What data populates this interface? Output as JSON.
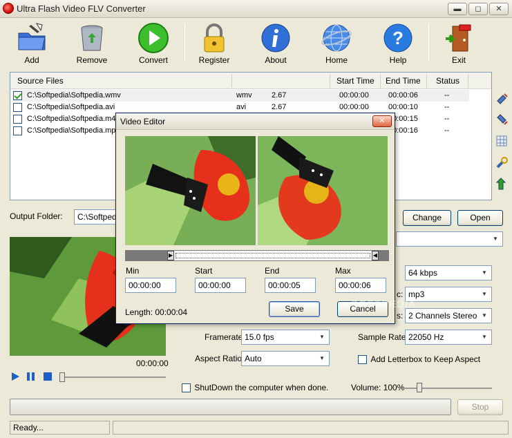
{
  "window": {
    "title": "Ultra Flash Video FLV Converter",
    "min": "▬",
    "max": "◻",
    "close": "✕"
  },
  "toolbar": [
    {
      "label": "Add",
      "icon": "add-folder-icon"
    },
    {
      "label": "Remove",
      "icon": "recycle-bin-icon"
    },
    {
      "label": "Convert",
      "icon": "play-convert-icon"
    },
    {
      "label": "Register",
      "icon": "lock-icon"
    },
    {
      "label": "About",
      "icon": "info-icon"
    },
    {
      "label": "Home",
      "icon": "globe-icon"
    },
    {
      "label": "Help",
      "icon": "help-icon"
    },
    {
      "label": "Exit",
      "icon": "exit-door-icon"
    }
  ],
  "file_list": {
    "headers": {
      "source": "Source Files",
      "start": "Start Time",
      "end": "End Time",
      "status": "Status"
    },
    "rows": [
      {
        "checked": true,
        "name": "C:\\Softpedia\\Softpedia.wmv",
        "type": "wmv",
        "size": "2.67",
        "start": "00:00:00",
        "end": "00:00:06",
        "status": "--"
      },
      {
        "checked": false,
        "name": "C:\\Softpedia\\Softpedia.avi",
        "type": "avi",
        "size": "2.67",
        "start": "00:00:00",
        "end": "00:00:10",
        "status": "--"
      },
      {
        "checked": false,
        "name": "C:\\Softpedia\\Softpedia.m4",
        "type": "",
        "size": "",
        "start": "",
        "end": "00:00:15",
        "status": "--"
      },
      {
        "checked": false,
        "name": "C:\\Softpedia\\Softpedia.mpe",
        "type": "",
        "size": "",
        "start": "",
        "end": "00:00:16",
        "status": "--"
      }
    ]
  },
  "output": {
    "label": "Output Folder:",
    "value": "C:\\Softpedia",
    "change": "Change",
    "open": "Open"
  },
  "preview": {
    "time": "00:00:00"
  },
  "settings": {
    "framerate_label": "Framerate:",
    "framerate": "15.0  fps",
    "aspect_label": "Aspect Ratio:",
    "aspect": "Auto",
    "bitrate_label": "y:",
    "bitrate": "64  kbps",
    "codec_label": "c:",
    "codec": "mp3",
    "channels_label": "s:",
    "channels": "2 Channels Stereo",
    "samplerate_label": "Sample Rate:",
    "samplerate": "22050 Hz",
    "letterbox_label": "Add Letterbox to Keep Aspect"
  },
  "footer": {
    "shutdown": "ShutDown the computer when done.",
    "volume": "Volume: 100%",
    "volume_level": 1.0,
    "stop": "Stop",
    "status": "Ready...",
    "progress": 0
  },
  "editor": {
    "title": "Video Editor",
    "min_label": "Min",
    "start_label": "Start",
    "end_label": "End",
    "max_label": "Max",
    "min": "00:00:00",
    "start": "00:00:00",
    "end": "00:00:05",
    "max": "00:00:06",
    "length": "Length: 00:00:04",
    "save": "Save",
    "cancel": "Cancel",
    "close": "✕"
  },
  "watermark": "SOFTPEDIA"
}
